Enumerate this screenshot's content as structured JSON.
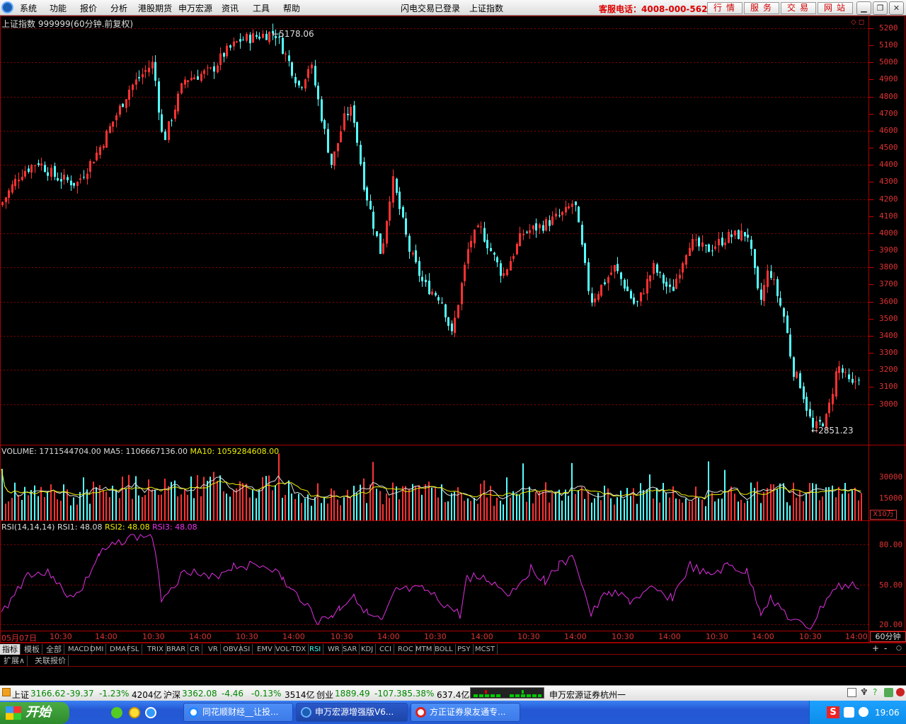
{
  "menubar": {
    "items": [
      "系统",
      "功能",
      "报价",
      "分析",
      "港股期货",
      "申万宏源",
      "资讯",
      "工具",
      "帮助"
    ],
    "login_status": "闪电交易已登录",
    "index_name": "上证指数",
    "hotline": "客服电话：4008-000-562",
    "top_buttons": [
      "行情",
      "服务",
      "交易",
      "网站"
    ]
  },
  "chart": {
    "title": "上证指数 999999(60分钟.前复权)",
    "high_label": "5178.06",
    "low_label": "2851.23",
    "price_axis": [
      "5200",
      "5100",
      "5000",
      "4900",
      "4800",
      "4700",
      "4600",
      "4500",
      "4400",
      "4300",
      "4200",
      "4100",
      "4000",
      "3900",
      "3800",
      "3700",
      "3600",
      "3500",
      "3400",
      "3300",
      "3200",
      "3100",
      "3000"
    ],
    "up_color": "#ff3232",
    "down_color": "#54ffff"
  },
  "volume": {
    "label": "VOLUME: 1711544704.00",
    "ma5": "MA5: 1106667136.00",
    "ma10": "MA10: 1059284608.00",
    "axis": [
      "30000",
      "15000"
    ],
    "unit": "X10万"
  },
  "rsi": {
    "label": "RSI(14,14,14)",
    "rsi1": "RSI1: 48.08",
    "rsi2": "RSI2: 48.08",
    "rsi3": "RSI3: 48.08",
    "axis": [
      "80.00",
      "50.00",
      "20.00"
    ]
  },
  "time_axis": {
    "labels": [
      "05月07日",
      "10:30",
      "14:00",
      "10:30",
      "14:00",
      "10:30",
      "14:00",
      "10:30",
      "14:00",
      "10:30",
      "14:00",
      "10:30",
      "14:00",
      "10:30",
      "14:00",
      "10:30",
      "14:00",
      "10:30",
      "14:00"
    ],
    "period": "60分钟"
  },
  "indicator_tabs": [
    "指标",
    "模板",
    "全部",
    "MACD",
    "DMI",
    "DMA",
    "FSL",
    "TRIX",
    "BRAR",
    "CR",
    "VR",
    "OBV",
    "ASI",
    "EMV",
    "VOL-TDX",
    "RSI",
    "WR",
    "SAR",
    "KDJ",
    "CCI",
    "ROC",
    "MTM",
    "BOLL",
    "PSY",
    "MCST"
  ],
  "extra_tabs": [
    "扩展∧",
    "关联报价"
  ],
  "statusbar": {
    "sh_name": "上证",
    "sh_price": "3166.62",
    "sh_chg": "-39.37",
    "sh_pct": "-1.23%",
    "sh_amt": "4204亿",
    "hs_name": "沪深",
    "hs_price": "3362.08",
    "hs_chg": "-4.46",
    "hs_pct": "-0.13%",
    "hs_amt": "3514亿",
    "cy_name": "创业",
    "cy_price": "1889.49",
    "cy_chg": "-107.38",
    "cy_pct": "-5.38%",
    "cy_amt": "637.4亿",
    "broker": "申万宏源证券杭州一"
  },
  "taskbar": {
    "start": "开始",
    "tasks": [
      "同花顺财经__让投...",
      "申万宏源增强版V6...",
      "方正证券泉友通专..."
    ],
    "clock": "19:06"
  }
}
